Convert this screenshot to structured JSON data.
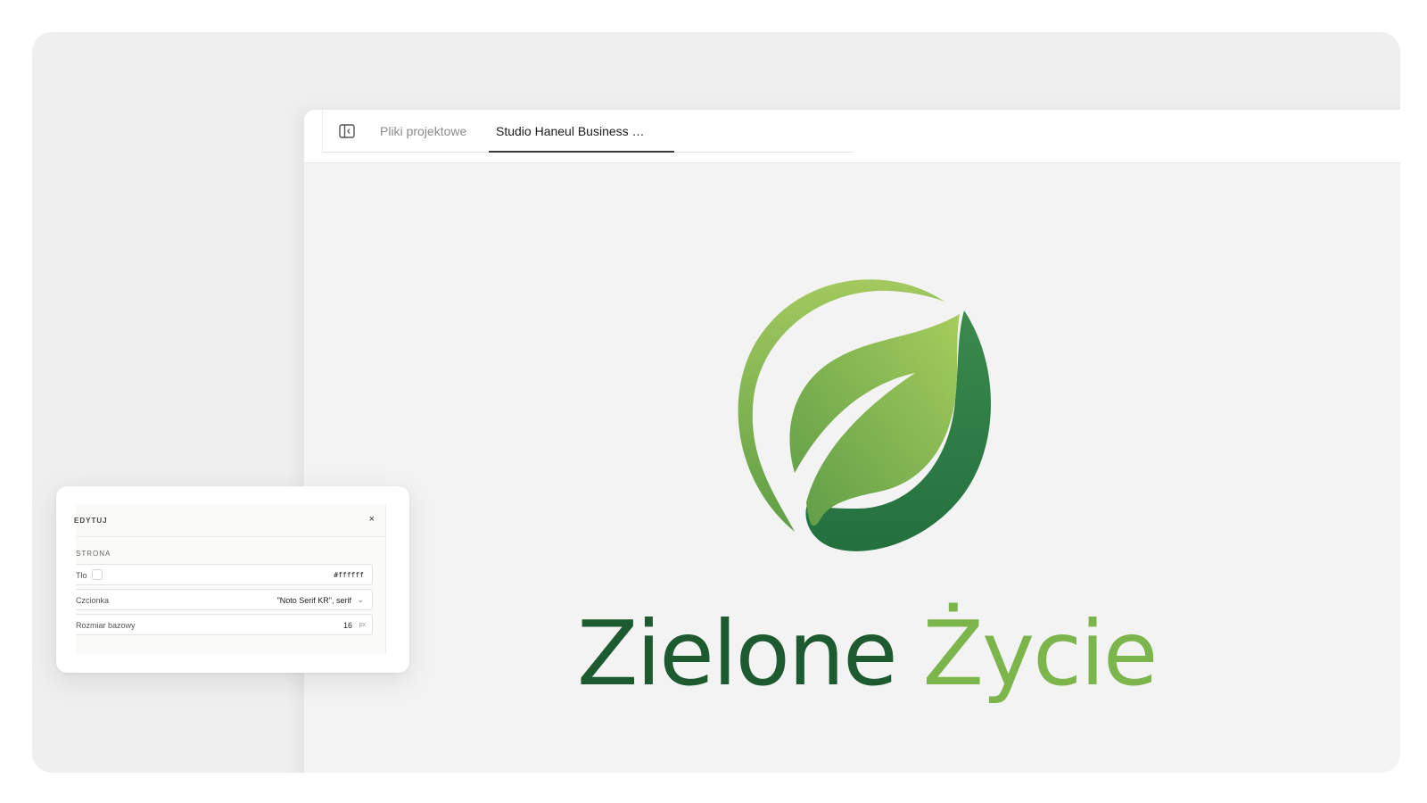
{
  "tabs": {
    "files_label": "Pliki projektowe",
    "active_label": "Studio Haneul Business …"
  },
  "logo": {
    "word_dark": "Zielone",
    "word_light": "Życie",
    "colors": {
      "dark_green": "#1e5a2f",
      "light_green": "#7db54d",
      "deep_leaf": "#2c7a48",
      "ring": "#8cbf56"
    }
  },
  "edit_panel": {
    "title": "EDYTUJ",
    "close": "×",
    "section": "STRONA",
    "rows": [
      {
        "label": "Tło",
        "value": "#ffffff"
      },
      {
        "label": "Czcionka",
        "value": "\"Noto Serif KR\", serif"
      },
      {
        "label": "Rozmiar bazowy",
        "value": "16",
        "unit": "px"
      }
    ]
  }
}
